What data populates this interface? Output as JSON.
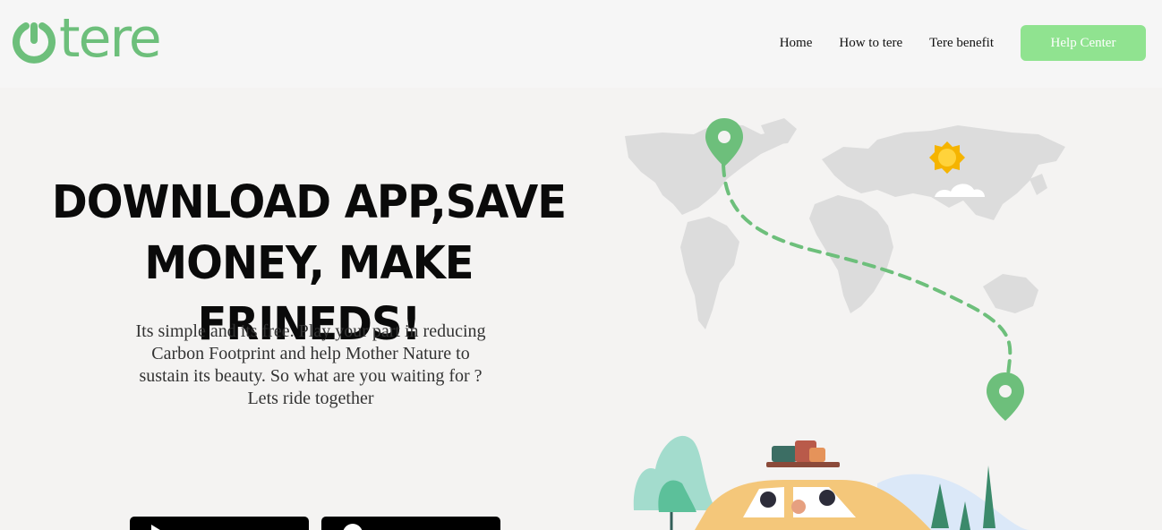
{
  "brand": {
    "name": "tere",
    "color": "#6dbf7b"
  },
  "nav": {
    "items": [
      {
        "label": "Home"
      },
      {
        "label": "How to tere"
      },
      {
        "label": "Tere benefit"
      }
    ],
    "cta_label": "Help Center",
    "cta_color": "#90e390"
  },
  "hero": {
    "headline_line1": "DOWNLOAD APP,SAVE",
    "headline_line2": "MONEY, MAKE FRINEDS!",
    "description": "Its simple and its free. Play your part in reducing Carbon Footprint and help Mother Nature to sustain its beauty. So what are you waiting for ? Lets ride together"
  },
  "downloads": [
    {
      "icon": "play-store-icon"
    },
    {
      "icon": "apple-icon"
    }
  ],
  "illustration": {
    "icons": [
      "world-map",
      "location-pin-icon",
      "sun-icon",
      "cloud-icon",
      "car-icon",
      "tree-icon"
    ]
  }
}
